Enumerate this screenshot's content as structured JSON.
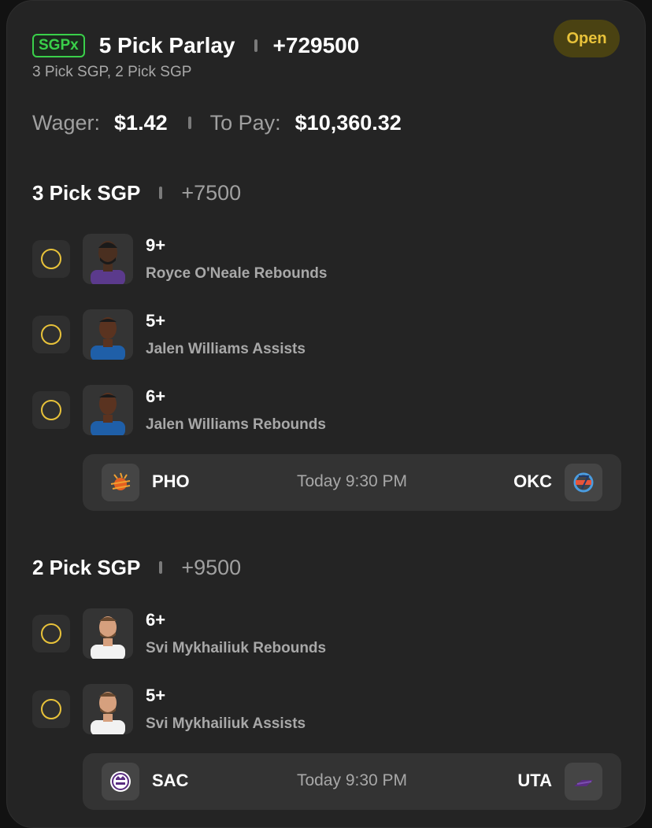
{
  "header": {
    "badge": "SGPx",
    "title": "5 Pick Parlay",
    "odds": "+729500",
    "status": "Open",
    "subtitle": "3 Pick SGP, 2 Pick SGP"
  },
  "wager": {
    "wager_label": "Wager:",
    "wager_value": "$1.42",
    "pay_label": "To Pay:",
    "pay_value": "$10,360.32"
  },
  "sections": [
    {
      "title": "3 Pick SGP",
      "odds": "+7500",
      "picks": [
        {
          "line": "9+",
          "desc": "Royce O'Neale Rebounds",
          "jersey": "#5b3a8c"
        },
        {
          "line": "5+",
          "desc": "Jalen Williams Assists",
          "jersey": "#1f5fa8"
        },
        {
          "line": "6+",
          "desc": "Jalen Williams Rebounds",
          "jersey": "#1f5fa8"
        }
      ],
      "game": {
        "home": "PHO",
        "away": "OKC",
        "time": "Today 9:30 PM",
        "home_logo": "suns-logo-icon",
        "away_logo": "thunder-logo-icon"
      }
    },
    {
      "title": "2 Pick SGP",
      "odds": "+9500",
      "picks": [
        {
          "line": "6+",
          "desc": "Svi Mykhailiuk Rebounds",
          "jersey": "#ffffff"
        },
        {
          "line": "5+",
          "desc": "Svi Mykhailiuk Assists",
          "jersey": "#ffffff"
        }
      ],
      "game": {
        "home": "SAC",
        "away": "UTA",
        "time": "Today 9:30 PM",
        "home_logo": "kings-logo-icon",
        "away_logo": "jazz-logo-icon"
      }
    }
  ],
  "colors": {
    "accent_yellow": "#e8c23a",
    "badge_green": "#3ad04a",
    "card_bg": "#242424"
  }
}
